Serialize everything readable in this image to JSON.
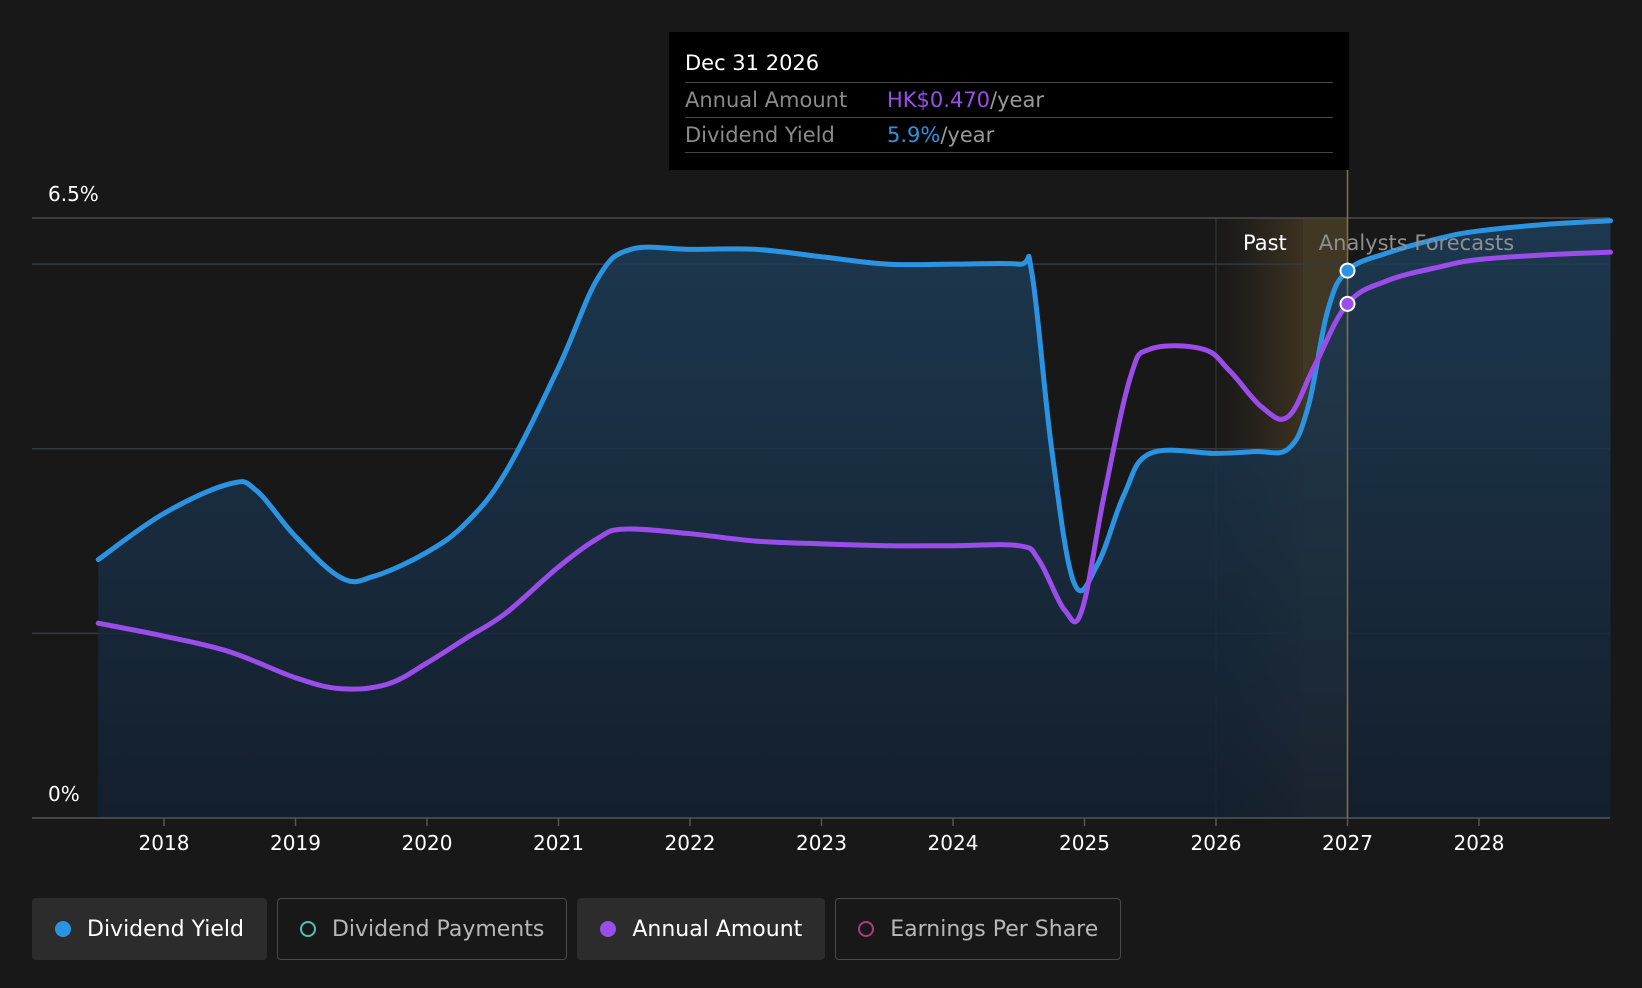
{
  "chart_data": {
    "type": "line",
    "y_axis": {
      "top_label": "6.5%",
      "bottom_label": "0%",
      "ylim": [
        0,
        6.5
      ]
    },
    "x_axis": {
      "ticks": [
        "2018",
        "2019",
        "2020",
        "2021",
        "2022",
        "2023",
        "2024",
        "2025",
        "2026",
        "2027",
        "2028"
      ],
      "xlim": [
        2017.5,
        2029.0
      ]
    },
    "regions": {
      "past_label": "Past",
      "forecast_label": "Analysts Forecasts",
      "past_start": 2026.0,
      "forecast_start": 2026.66,
      "cursor": 2027.0
    },
    "series": [
      {
        "name": "Dividend Yield",
        "color": "#2b94e2",
        "filled": true,
        "points": [
          [
            2017.5,
            2.8
          ],
          [
            2018.0,
            3.3
          ],
          [
            2018.5,
            3.62
          ],
          [
            2018.7,
            3.55
          ],
          [
            2019.0,
            3.05
          ],
          [
            2019.35,
            2.6
          ],
          [
            2019.6,
            2.62
          ],
          [
            2020.0,
            2.88
          ],
          [
            2020.3,
            3.2
          ],
          [
            2020.6,
            3.75
          ],
          [
            2021.0,
            4.88
          ],
          [
            2021.3,
            5.85
          ],
          [
            2021.55,
            6.16
          ],
          [
            2022.0,
            6.16
          ],
          [
            2022.5,
            6.16
          ],
          [
            2023.0,
            6.08
          ],
          [
            2023.5,
            6.0
          ],
          [
            2024.0,
            6.0
          ],
          [
            2024.5,
            6.0
          ],
          [
            2024.6,
            5.9
          ],
          [
            2024.75,
            4.0
          ],
          [
            2024.92,
            2.55
          ],
          [
            2025.1,
            2.75
          ],
          [
            2025.3,
            3.5
          ],
          [
            2025.5,
            3.95
          ],
          [
            2026.0,
            3.95
          ],
          [
            2026.3,
            3.97
          ],
          [
            2026.55,
            4.0
          ],
          [
            2026.7,
            4.45
          ],
          [
            2026.85,
            5.5
          ],
          [
            2027.0,
            5.93
          ],
          [
            2027.3,
            6.12
          ],
          [
            2027.7,
            6.28
          ],
          [
            2028.0,
            6.36
          ],
          [
            2028.5,
            6.43
          ],
          [
            2029.0,
            6.47
          ]
        ]
      },
      {
        "name": "Annual Amount",
        "color": "#9b4dea",
        "filled": false,
        "points": [
          [
            2017.5,
            2.11
          ],
          [
            2018.0,
            1.97
          ],
          [
            2018.5,
            1.8
          ],
          [
            2019.0,
            1.52
          ],
          [
            2019.35,
            1.4
          ],
          [
            2019.7,
            1.45
          ],
          [
            2020.0,
            1.68
          ],
          [
            2020.3,
            1.95
          ],
          [
            2020.6,
            2.22
          ],
          [
            2021.0,
            2.72
          ],
          [
            2021.3,
            3.03
          ],
          [
            2021.5,
            3.13
          ],
          [
            2022.0,
            3.08
          ],
          [
            2022.5,
            3.0
          ],
          [
            2023.0,
            2.97
          ],
          [
            2023.5,
            2.95
          ],
          [
            2024.0,
            2.95
          ],
          [
            2024.5,
            2.95
          ],
          [
            2024.65,
            2.8
          ],
          [
            2024.85,
            2.25
          ],
          [
            2024.98,
            2.25
          ],
          [
            2025.15,
            3.5
          ],
          [
            2025.35,
            4.78
          ],
          [
            2025.5,
            5.08
          ],
          [
            2025.9,
            5.08
          ],
          [
            2026.1,
            4.85
          ],
          [
            2026.35,
            4.45
          ],
          [
            2026.55,
            4.35
          ],
          [
            2026.75,
            4.9
          ],
          [
            2027.0,
            5.57
          ],
          [
            2027.3,
            5.82
          ],
          [
            2027.7,
            5.97
          ],
          [
            2028.0,
            6.05
          ],
          [
            2028.5,
            6.1
          ],
          [
            2029.0,
            6.13
          ]
        ]
      }
    ]
  },
  "tooltip": {
    "date": "Dec 31 2026",
    "rows": [
      {
        "label": "Annual Amount",
        "value": "HK$0.470",
        "unit": "/year",
        "color": "#9b4dea"
      },
      {
        "label": "Dividend Yield",
        "value": "5.9%",
        "unit": "/year",
        "color": "#2b94e2"
      }
    ]
  },
  "legend": [
    {
      "label": "Dividend Yield",
      "color": "#2b94e2",
      "active": true
    },
    {
      "label": "Dividend Payments",
      "color": "#4fc3b0",
      "active": false
    },
    {
      "label": "Annual Amount",
      "color": "#9b4dea",
      "active": true
    },
    {
      "label": "Earnings Per Share",
      "color": "#b03a7a",
      "active": false
    }
  ]
}
